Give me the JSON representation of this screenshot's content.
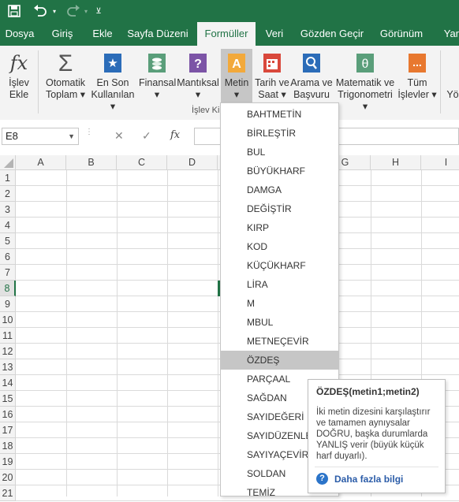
{
  "tabs": [
    "Dosya",
    "Giriş",
    "Ekle",
    "Sayfa Düzeni",
    "Formüller",
    "Veri",
    "Gözden Geçir",
    "Görünüm",
    "Yard"
  ],
  "active_tab": "Formüller",
  "ribbon": {
    "insert_function": [
      "İşlev",
      "Ekle"
    ],
    "autosum": [
      "Otomatik",
      "Toplam ▾"
    ],
    "recent": [
      "En Son",
      "Kullanılan ▾"
    ],
    "financial": [
      "Finansal",
      "▾"
    ],
    "logical": [
      "Mantıksal",
      "▾"
    ],
    "text": [
      "Metin",
      "▾"
    ],
    "datetime": [
      "Tarih ve",
      "Saat ▾"
    ],
    "lookup": [
      "Arama ve",
      "Başvuru ▾"
    ],
    "math": [
      "Matematik ve",
      "Trigonometri ▾"
    ],
    "more": [
      "Tüm",
      "İşlevler ▾"
    ],
    "cut_label": "Yö",
    "group_label": "İşlev Ki"
  },
  "formula_bar": {
    "name_box": "E8",
    "cancel_icon": "✕",
    "enter_icon": "✓",
    "fx_icon": "fx",
    "formula": ""
  },
  "columns": [
    "A",
    "B",
    "C",
    "D",
    "E",
    "G",
    "H",
    "I"
  ],
  "rows": [
    "1",
    "2",
    "3",
    "4",
    "5",
    "6",
    "7",
    "8",
    "9",
    "10",
    "11",
    "12",
    "13",
    "14",
    "15",
    "16",
    "17",
    "18",
    "19",
    "20",
    "21"
  ],
  "active_row": "8",
  "menu": {
    "items": [
      "BAHTMETİN",
      "BİRLEŞTİR",
      "BUL",
      "BÜYÜKHARF",
      "DAMGA",
      "DEĞİŞTİR",
      "KIRP",
      "KOD",
      "KÜÇÜKHARF",
      "LİRA",
      "M",
      "MBUL",
      "METNEÇEVİR",
      "ÖZDEŞ",
      "PARÇAAL",
      "SAĞDAN",
      "SAYIDEĞERİ",
      "SAYIDÜZENLE",
      "SAYIYAÇEVİR",
      "SOLDAN",
      "TEMİZ"
    ],
    "highlighted": "ÖZDEŞ"
  },
  "tooltip": {
    "title": "ÖZDEŞ(metin1;metin2)",
    "lines": [
      "İki metin dizesini karşılaştırır",
      "ve tamamen aynıysalar",
      "DOĞRU, başka durumlarda",
      "YANLIŞ verir (büyük küçük",
      "harf duyarlı)."
    ],
    "link": "Daha fazla bilgi"
  },
  "colors": {
    "brand": "#217346",
    "highlight": "#c6c6c6",
    "link": "#2b5ca8"
  }
}
